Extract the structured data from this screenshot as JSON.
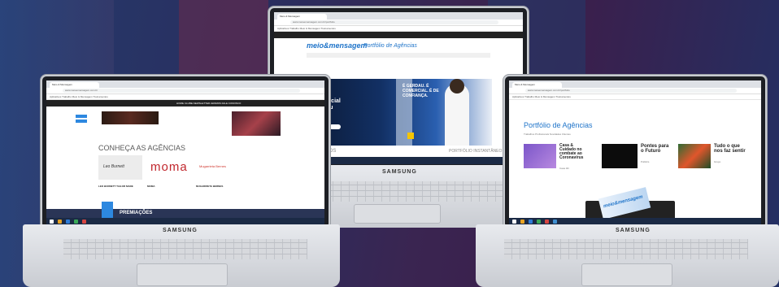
{
  "laptop_brand": "SAMSUNG",
  "browser": {
    "tab_title": "Meio & Mensagem",
    "bookmarks": "Aplicativos   Trabalho   Meio & Mensagem   Treinamentos"
  },
  "left_screen": {
    "site_nav": "HOME  CLUBE  NEWSLETTER  AWARDS  FALE CONOSCO",
    "section_heading": "CONHEÇA AS AGÊNCIAS",
    "agency_logos": [
      "Leo Burnett",
      "moma",
      "Mugarrieta Bernes"
    ],
    "agency_names": [
      "LEO BURNETT TAILOR MADE",
      "MOMA",
      "MUGARRIETA BERNES"
    ],
    "footer_label": "PREMIAÇÕES"
  },
  "center_screen": {
    "site_logo": "meio&mensagem",
    "site_title": "Portfólio de Agências",
    "hero_kicker": "Comercial",
    "hero_title": "Comercial Gerdau",
    "hero_slogan": "É GERDAU. É COMERCIAL. É DE CONFIANÇA.",
    "bottom_left": "TRABALHOS",
    "bottom_right": "PORTFÓLIO INSTANTÂNEO"
  },
  "right_screen": {
    "page_title": "Portfólio de Agências",
    "filters": "Trabalhos  Profissionais  Novidades  Clientes",
    "cards": [
      {
        "title": "Casa & Cuidado no combate ao Coronavírus",
        "meta": "Casa 4D"
      },
      {
        "title": "Pontes para o Futuro",
        "meta": "Publicis"
      },
      {
        "title": "Tudo o que nos faz sentir",
        "meta": "Grupo"
      }
    ],
    "magazine": "meio&mensagem"
  },
  "colors": {
    "mm_blue": "#1f74c9",
    "taskbar": "#1b2a45",
    "background": "#2b2d5e"
  }
}
